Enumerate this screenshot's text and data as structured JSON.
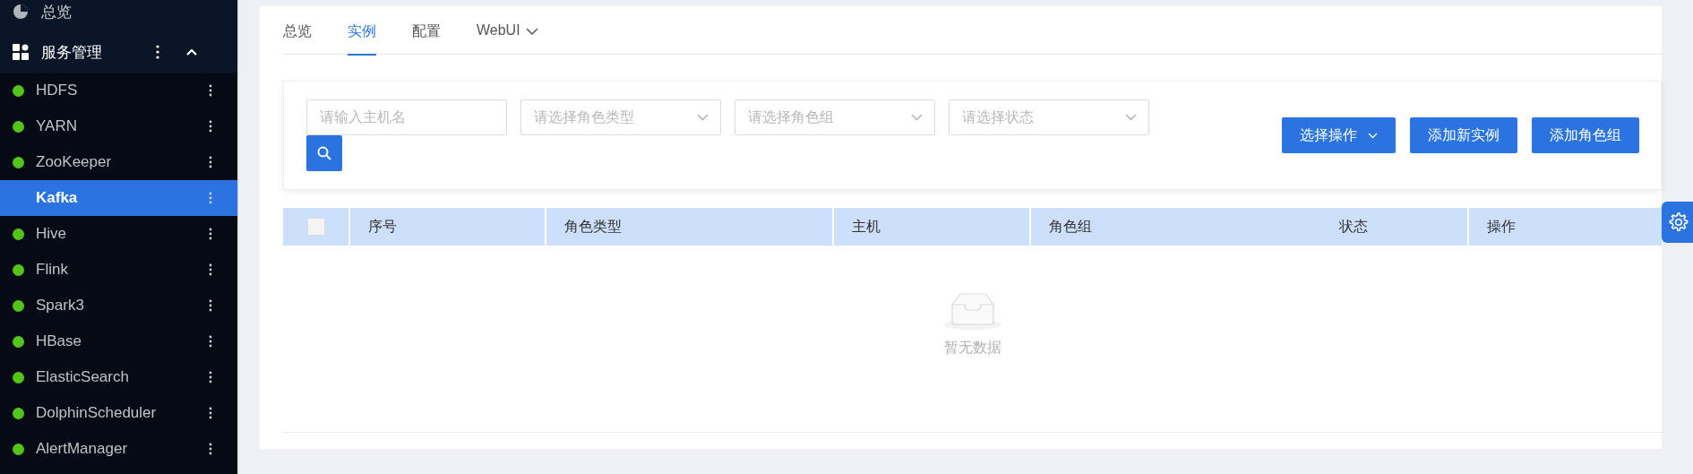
{
  "sidebar": {
    "overview": {
      "label": "总览"
    },
    "group": {
      "label": "服务管理",
      "expanded": true
    },
    "items": [
      {
        "label": "HDFS",
        "selected": false,
        "color": "#52c41a"
      },
      {
        "label": "YARN",
        "selected": false,
        "color": "#52c41a"
      },
      {
        "label": "ZooKeeper",
        "selected": false,
        "color": "#52c41a"
      },
      {
        "label": "Kafka",
        "selected": true
      },
      {
        "label": "Hive",
        "selected": false,
        "color": "#52c41a"
      },
      {
        "label": "Flink",
        "selected": false,
        "color": "#52c41a"
      },
      {
        "label": "Spark3",
        "selected": false,
        "color": "#52c41a"
      },
      {
        "label": "HBase",
        "selected": false,
        "color": "#52c41a"
      },
      {
        "label": "ElasticSearch",
        "selected": false,
        "color": "#52c41a"
      },
      {
        "label": "DolphinScheduler",
        "selected": false,
        "color": "#52c41a"
      },
      {
        "label": "AlertManager",
        "selected": false,
        "color": "#52c41a"
      }
    ]
  },
  "tabs": [
    {
      "label": "总览",
      "selected": false,
      "kind": "plain"
    },
    {
      "label": "实例",
      "selected": true,
      "kind": "plain"
    },
    {
      "label": "配置",
      "selected": false,
      "kind": "plain"
    },
    {
      "label": "WebUI",
      "selected": false,
      "kind": "dropdown"
    }
  ],
  "filters": [
    {
      "placeholder": "请输入主机名",
      "kind": "input"
    },
    {
      "placeholder": "请选择角色类型",
      "kind": "select"
    },
    {
      "placeholder": "请选择角色组",
      "kind": "select"
    },
    {
      "placeholder": "请选择状态",
      "kind": "select"
    }
  ],
  "actions": [
    {
      "label": "选择操作",
      "kind": "dropdown"
    },
    {
      "label": "添加新实例",
      "kind": "plain"
    },
    {
      "label": "添加角色组",
      "kind": "plain"
    }
  ],
  "table": {
    "select_all": {
      "checked": false
    },
    "columns": [
      {
        "label": "序号"
      },
      {
        "label": "角色类型"
      },
      {
        "label": "主机"
      },
      {
        "label": "角色组"
      },
      {
        "label": "状态"
      },
      {
        "label": "操作"
      }
    ],
    "empty_text": "暂无数据"
  }
}
